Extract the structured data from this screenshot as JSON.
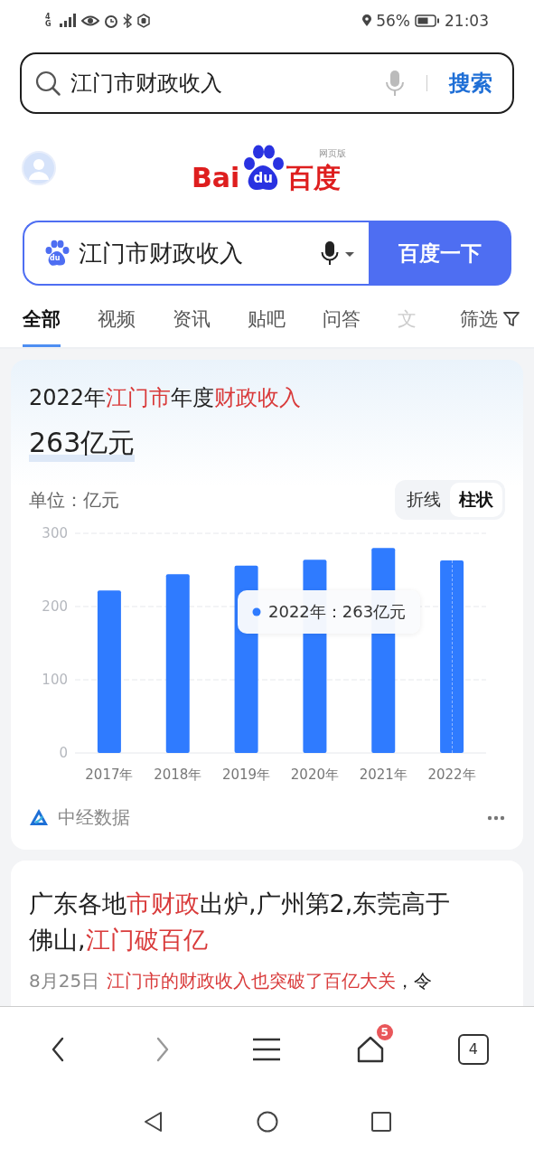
{
  "status_bar": {
    "network": "4G",
    "battery": "56%",
    "time": "21:03"
  },
  "browser_search": {
    "value": "江门市财政收入",
    "button": "搜索"
  },
  "logo": {
    "left": "Bai",
    "paw": "du",
    "right": "百度",
    "edition": "网页版"
  },
  "baidu_search": {
    "paw": "du",
    "value": "江门市财政收入",
    "button": "百度一下"
  },
  "tabs": [
    {
      "label": "全部",
      "selected": true,
      "faded": false
    },
    {
      "label": "视频",
      "selected": false,
      "faded": false
    },
    {
      "label": "资讯",
      "selected": false,
      "faded": false
    },
    {
      "label": "贴吧",
      "selected": false,
      "faded": false
    },
    {
      "label": "问答",
      "selected": false,
      "faded": false
    },
    {
      "label": "文",
      "selected": false,
      "faded": true
    }
  ],
  "filter": "筛选",
  "result_card": {
    "title": [
      {
        "text": "2022年",
        "highlight": false
      },
      {
        "text": "江门市",
        "highlight": true
      },
      {
        "text": "年度",
        "highlight": false
      },
      {
        "text": "财政收入",
        "highlight": true
      }
    ],
    "value": "263亿元",
    "unit": "单位：亿元",
    "toggle": [
      {
        "label": "折线",
        "selected": false
      },
      {
        "label": "柱状",
        "selected": true
      }
    ],
    "chart_data": {
      "type": "bar",
      "categories": [
        "2017年",
        "2018年",
        "2019年",
        "2020年",
        "2021年",
        "2022年"
      ],
      "series": [
        {
          "color": "#2f7bff",
          "values": [
            222,
            244,
            256,
            264,
            280,
            263
          ]
        }
      ],
      "ylim": [
        0,
        300
      ],
      "yticks": [
        0,
        100,
        200,
        300
      ],
      "ref_lines": [
        {
          "axis": "x",
          "value": "2022年"
        }
      ]
    },
    "tooltip": {
      "text": "2022年：263亿元"
    },
    "source": "中经数据"
  },
  "article": {
    "title": [
      {
        "text": "广东各地",
        "highlight": false
      },
      {
        "text": "市财政",
        "highlight": true
      },
      {
        "text": "出炉,广州第2,东莞高于佛山,",
        "highlight": false
      },
      {
        "text": "江门破百亿",
        "highlight": true
      }
    ],
    "date": "8月25日",
    "snippet": [
      {
        "text": "江门市的财政收入也突破了百亿大关",
        "highlight": true
      },
      {
        "text": "，令",
        "highlight": false
      }
    ]
  },
  "bottom_nav": [
    {
      "kind": "back",
      "disabled": false
    },
    {
      "kind": "forward",
      "disabled": true
    },
    {
      "kind": "menu",
      "disabled": false
    },
    {
      "kind": "home",
      "disabled": false,
      "badge": "5"
    },
    {
      "kind": "tabs",
      "disabled": false,
      "count": "4"
    }
  ]
}
